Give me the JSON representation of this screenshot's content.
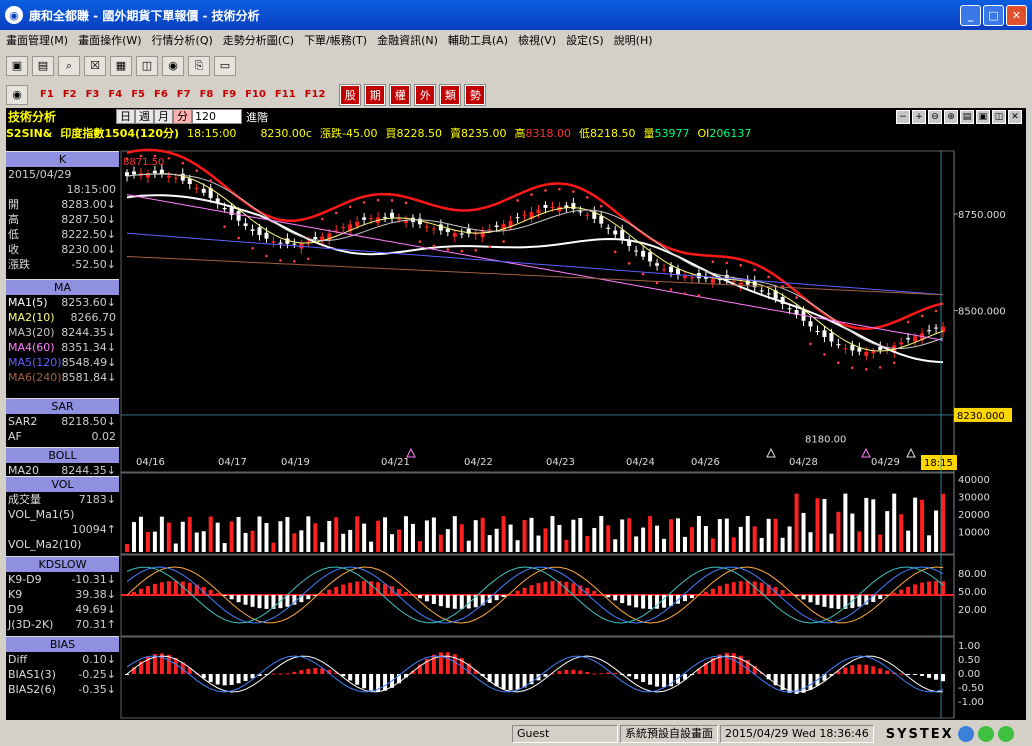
{
  "window": {
    "title": "康和全都賺 - 國外期貨下單報價 - 技術分析",
    "min": "_",
    "max": "□",
    "close": "✕"
  },
  "menu": [
    "畫面管理(M)",
    "畫面操作(W)",
    "行情分析(Q)",
    "走勢分析圖(C)",
    "下單/帳務(T)",
    "金融資訊(N)",
    "輔助工具(A)",
    "檢視(V)",
    "設定(S)",
    "說明(H)"
  ],
  "fkeys": [
    "F1",
    "F2",
    "F3",
    "F4",
    "F5",
    "F6",
    "F7",
    "F8",
    "F9",
    "F10",
    "F11",
    "F12"
  ],
  "cat_buttons": [
    "股",
    "期",
    "權",
    "外",
    "類",
    "勢"
  ],
  "chart_header": {
    "title": "技術分析",
    "periods": [
      "日",
      "週",
      "月",
      "分"
    ],
    "selected_period": "分",
    "interval": "120",
    "go": "進階"
  },
  "quote": {
    "symbol": "S2SIN&",
    "name": "印度指數1504(120分)",
    "time": "18:15:00",
    "last": "8230.00c",
    "change_label": "漲跌",
    "change": "-45.00",
    "bid_label": "買",
    "bid": "8228.50",
    "ask_label": "賣",
    "ask": "8235.00",
    "high_label": "高",
    "high": "8318.00",
    "low_label": "低",
    "low": "8218.50",
    "vol_label": "量",
    "vol": "53977",
    "oi_label": "OI",
    "oi": "206137"
  },
  "sidebar": {
    "k": {
      "header": "K",
      "date": "2015/04/29",
      "time": "18:15:00",
      "rows": [
        {
          "l": "開",
          "v": "8283.00↓"
        },
        {
          "l": "高",
          "v": "8287.50↓"
        },
        {
          "l": "低",
          "v": "8222.50↓"
        },
        {
          "l": "收",
          "v": "8230.00↓"
        },
        {
          "l": "漲跌",
          "v": "-52.50↓"
        }
      ]
    },
    "ma": {
      "header": "MA",
      "rows": [
        {
          "l": "MA1(5)",
          "v": "8253.60↓",
          "c": "#ffffff"
        },
        {
          "l": "MA2(10)",
          "v": "8266.70",
          "c": "#ffff80"
        },
        {
          "l": "MA3(20)",
          "v": "8244.35↓",
          "c": "#c8c8c8"
        },
        {
          "l": "MA4(60)",
          "v": "8351.34↓",
          "c": "#ff80ff"
        },
        {
          "l": "MA5(120)",
          "v": "8548.49↓",
          "c": "#6060ff"
        },
        {
          "l": "MA6(240)",
          "v": "8581.84↓",
          "c": "#a06040"
        }
      ]
    },
    "sar": {
      "header": "SAR",
      "rows": [
        {
          "l": "SAR2",
          "v": "8218.50↓"
        },
        {
          "l": "AF",
          "v": "0.02"
        }
      ]
    },
    "boll": {
      "header": "BOLL",
      "rows": [
        {
          "l": "MA20",
          "v": "8244.35↓"
        }
      ]
    },
    "vol": {
      "header": "VOL",
      "rows": [
        {
          "l": "成交量",
          "v": "7183↓"
        },
        {
          "l": "VOL_Ma1(5)",
          "v": ""
        },
        {
          "l": "",
          "v": "10094↑"
        },
        {
          "l": "VOL_Ma2(10)",
          "v": ""
        }
      ]
    },
    "kd": {
      "header": "KDSLOW",
      "rows": [
        {
          "l": "K9-D9",
          "v": "-10.31↓"
        },
        {
          "l": "K9",
          "v": "39.38↓"
        },
        {
          "l": "D9",
          "v": "49.69↓"
        },
        {
          "l": "J(3D-2K)",
          "v": "70.31↑"
        }
      ]
    },
    "bias": {
      "header": "BIAS",
      "rows": [
        {
          "l": "Diff",
          "v": "0.10↓"
        },
        {
          "l": "BIAS1(3)",
          "v": "-0.25↓"
        },
        {
          "l": "BIAS2(6)",
          "v": "-0.35↓"
        }
      ]
    }
  },
  "axes": {
    "price_ticks": [
      "8750.000",
      "8500.000",
      "8230.000"
    ],
    "vol_ticks": [
      "40000",
      "30000",
      "20000",
      "10000"
    ],
    "kd_ticks": [
      "80.00",
      "50.00",
      "20.00"
    ],
    "bias_ticks": [
      "1.00",
      "0.50",
      "0.00",
      "-0.50",
      "-1.00"
    ],
    "dates": [
      "04/16",
      "04/17",
      "04/19",
      "04/21",
      "04/22",
      "04/23",
      "04/24",
      "04/26",
      "04/28",
      "04/29"
    ],
    "time_flag": "18:15",
    "high_mark": "8871.50",
    "low_mark": "8180.00"
  },
  "status": {
    "user": "Guest",
    "layout": "系統預設自設畫面",
    "datetime": "2015/04/29 Wed 18:36:46",
    "brand": "SYSTEX"
  }
}
